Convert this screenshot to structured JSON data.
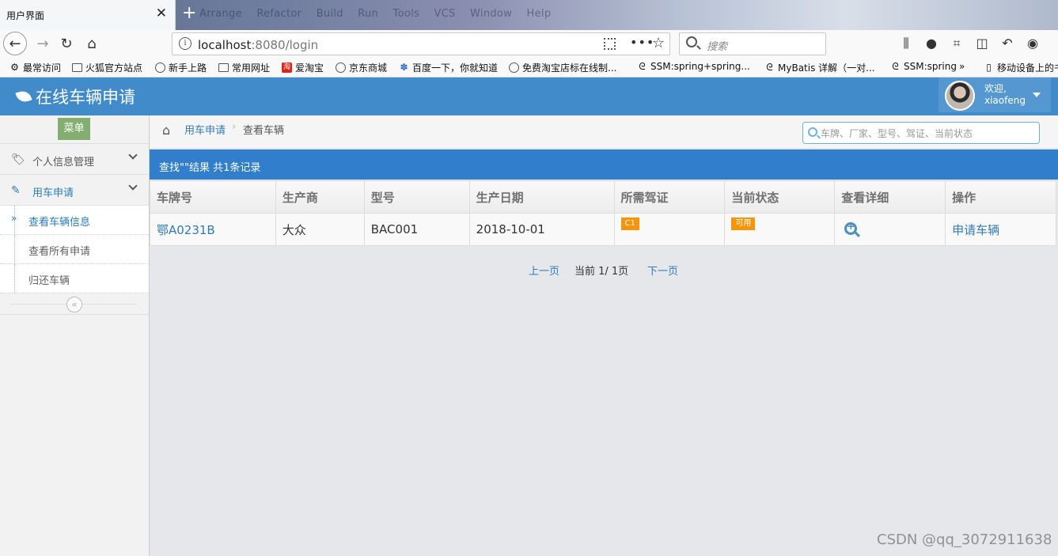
{
  "browser": {
    "tab_title": "用户界面",
    "tab_close": "✕",
    "new_tab": "+",
    "ghost_menu": "Arrange Refactor Build Run Tools VCS Window Help",
    "url_host": "localhost",
    "url_rest": ":8080/login",
    "search_placeholder": "搜索",
    "bookmarks": [
      {
        "label": "最常访问",
        "icon": "gear-icon"
      },
      {
        "label": "火狐官方站点",
        "icon": "folder-icon"
      },
      {
        "label": "新手上路",
        "icon": "globe-icon"
      },
      {
        "label": "常用网址",
        "icon": "folder-icon"
      },
      {
        "label": "爱淘宝",
        "icon": "taobao-icon"
      },
      {
        "label": "京东商城",
        "icon": "globe-icon"
      },
      {
        "label": "百度一下，你就知道",
        "icon": "baidu-paw-icon"
      },
      {
        "label": "免费淘宝店标在线制...",
        "icon": "globe-icon"
      },
      {
        "label": "SSM:spring+spring...",
        "icon": "swirl-icon"
      },
      {
        "label": "MyBatis 详解（一对...",
        "icon": "swirl-icon"
      },
      {
        "label": "SSM:spring",
        "icon": "swirl-icon"
      },
      {
        "label": "移动设备上的书",
        "icon": "phone-icon"
      }
    ]
  },
  "header": {
    "title": "在线车辆申请",
    "welcome": "欢迎,",
    "username": "xiaofeng"
  },
  "sidebar": {
    "menu_label": "菜单",
    "groups": [
      {
        "label": "个人信息管理"
      },
      {
        "label": "用车申请"
      }
    ],
    "sub_items": [
      {
        "label": "查看车辆信息"
      },
      {
        "label": "查看所有申请"
      },
      {
        "label": "归还车辆"
      }
    ],
    "collapse_glyph": "«"
  },
  "breadcrumb": {
    "parent": "用车申请",
    "current": "查看车辆",
    "separator": "›"
  },
  "search": {
    "placeholder": "车牌、厂家、型号、驾证、当前状态"
  },
  "result_text": "查找\"\"结果 共1条记录",
  "table": {
    "headers": [
      "车牌号",
      "生产商",
      "型号",
      "生产日期",
      "所需驾证",
      "当前状态",
      "查看详细",
      "操作"
    ],
    "rows": [
      {
        "plate": "鄂A0231B",
        "maker": "大众",
        "model": "BAC001",
        "date": "2018-10-01",
        "license": "C1",
        "status": "可用",
        "action": "申请车辆"
      }
    ]
  },
  "pager": {
    "prev": "上一页",
    "current": "当前 1/ 1页",
    "next": "下一页"
  },
  "watermark": "CSDN @qq_3072911638",
  "colors": {
    "header_blue": "#428bca",
    "result_bar": "#307ecc",
    "badge_orange": "#f89406",
    "menu_green": "#82af6f",
    "link_blue": "#337ab7"
  }
}
